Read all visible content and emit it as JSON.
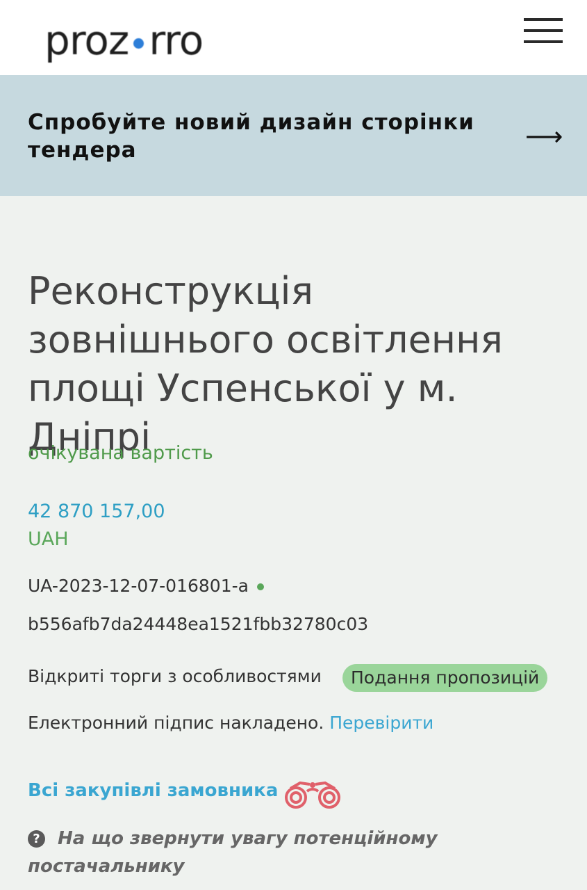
{
  "header": {
    "logo_left": "proz",
    "logo_right": "rro",
    "menu_icon": "hamburger-icon"
  },
  "banner": {
    "text": "Спробуйте новий дизайн сторінки тендера",
    "arrow": "⟶"
  },
  "tender": {
    "title": "Реконструкція зовнішнього освітлення площі Успенської у м. Дніпрі",
    "expected_label": "очікувана вартість",
    "amount": "42 870 157,00",
    "currency": "UAH",
    "id": "UA-2023-12-07-016801-a",
    "hash": "b556afb7da24448ea1521fbb32780c03",
    "procedure_type": "Відкриті торги з особливостями",
    "status": "Подання пропозицій",
    "signature_text": "Електронний підпис накладено.",
    "signature_link": "Перевірити",
    "all_purchases": "Всі закупівлі замовника",
    "hint": "На що звернути увагу потенційному постачальнику"
  },
  "colors": {
    "logo_dot": "#2d7ed8",
    "banner_bg": "#c6d9df",
    "status_bg": "#9ad59a",
    "link": "#3aa6d1",
    "green_text": "#4f9a4a",
    "binoculars": "#e0606a"
  }
}
